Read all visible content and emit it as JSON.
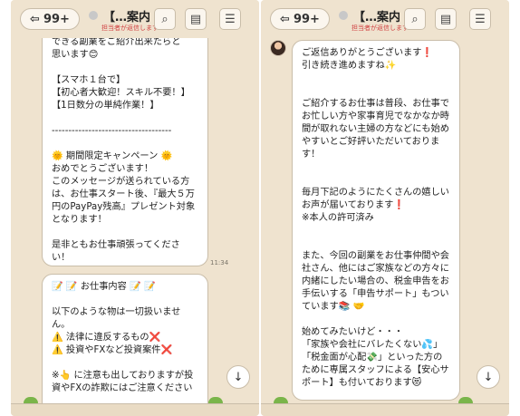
{
  "header": {
    "back_label": "99+",
    "title": "【…案内",
    "subtitle": "担当者が返信します"
  },
  "left_chat": {
    "bubble1": "できる副業をご紹介出来たらと\n思います😊\n\n【スマホ１台で】\n【初心者大歓迎！スキル不要！】\n【1日数分の単純作業！】\n\n------------------------------------\n\n🌞 期間限定キャンペーン 🌞\nおめでとうございます！\nこのメッセージが送られている方は、お仕事スタート後、『最大５万円のPayPay残高』プレゼント対象となります！\n\n是非ともお仕事頑張ってください！",
    "time1": "11:34",
    "bubble2": "📝 📝 お仕事内容 📝 📝\n\n以下のような物は一切扱いません。\n⚠️ 法律に違反するもの❌\n⚠️ 投資やFXなど投資案件❌\n\n※👆 に注意も出しておりますが投資やFXの詐欺にはご注意ください"
  },
  "right_chat": {
    "bubble1": "ご返信ありがとうございます❗\n引き続き進めますね✨\n\n\nご紹介するお仕事は普段、お仕事でお忙しい方や家事育児でなかなか時間が取れない主婦の方などにも始めやすいとご好評いただいております！\n\n\n毎月下記のようにたくさんの嬉しいお声が届いております❗\n※本人の許可済み\n\n\nまた、今回の副業をお仕事仲間や会社さん、他にはご家族などの方々に内緒にしたい場合の、税金申告をお手伝いする「申告サポート」もついています📚 🤝\n\n始めてみたいけど・・・\n「家族や会社にバレたくない💦」「税金面が心配💸」といった方のために専属スタッフによる【安心サポート】も付いております😻"
  },
  "icons": {
    "back": "back-arrow-icon",
    "search": "search-icon",
    "notes": "notes-icon",
    "menu": "menu-icon",
    "scroll": "scroll-down-icon"
  }
}
